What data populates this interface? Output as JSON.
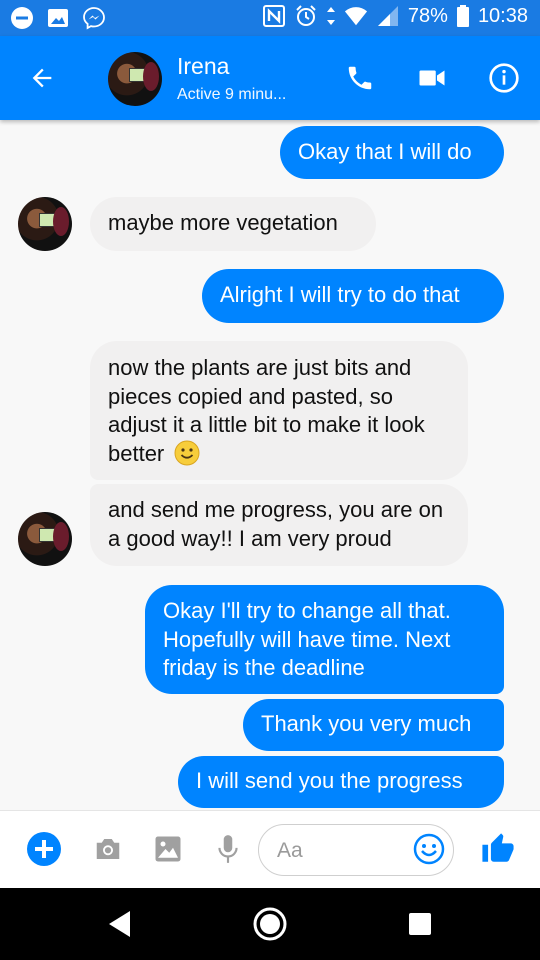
{
  "status_bar": {
    "battery": "78%",
    "time": "10:38",
    "left_icons": [
      "minus-circle-icon",
      "image-icon",
      "messenger-icon"
    ],
    "right_icons": [
      "nfc-icon",
      "alarm-icon",
      "data-arrows-icon",
      "wifi-icon",
      "signal-icon",
      "battery-icon"
    ]
  },
  "header": {
    "name": "Irena",
    "status": "Active 9 minu...",
    "actions": [
      "back-arrow-icon",
      "phone-icon",
      "video-camera-icon",
      "info-icon"
    ],
    "colors": {
      "header": "#0084ff",
      "status_bar": "#1a7be3"
    }
  },
  "messages": [
    {
      "from": "me",
      "text": "Okay that I will do"
    },
    {
      "from": "Irena",
      "text": "maybe more vegetation"
    },
    {
      "from": "me",
      "text": "Alright I will try to do that"
    },
    {
      "from": "Irena",
      "text": "now the plants are just bits and pieces copied and pasted, so adjust it a little bit to make it look better",
      "emoji": "smiling-face-emoji"
    },
    {
      "from": "Irena",
      "text": "and send me progress, you are on a good way!! I am very proud"
    },
    {
      "from": "me",
      "text": "Okay I'll try to change all that. Hopefully will have time. Next friday is the deadline"
    },
    {
      "from": "me",
      "text": "Thank you very much"
    },
    {
      "from": "me",
      "text": "I will send you the progress"
    }
  ],
  "composer": {
    "placeholder": "Aa",
    "icons": [
      "plus-icon",
      "camera-icon",
      "gallery-icon",
      "microphone-icon",
      "emoji-icon",
      "like-icon"
    ],
    "accent": "#0084ff"
  },
  "nav_bar": {
    "icons": [
      "back-triangle-icon",
      "home-circle-icon",
      "recents-square-icon"
    ]
  }
}
